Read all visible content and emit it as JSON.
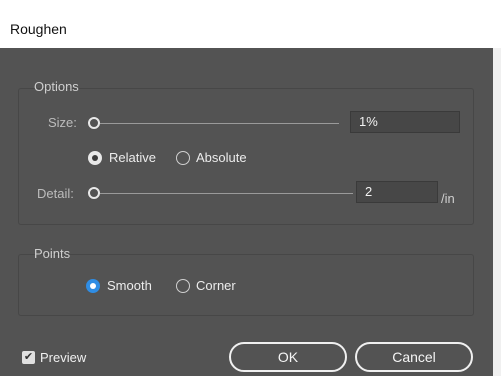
{
  "window": {
    "title": "Roughen"
  },
  "options": {
    "group_label": "Options",
    "size": {
      "label": "Size:",
      "value": "1%",
      "slider_fraction": 0.0
    },
    "mode": {
      "options": [
        {
          "label": "Relative",
          "selected": true
        },
        {
          "label": "Absolute",
          "selected": false
        }
      ]
    },
    "detail": {
      "label": "Detail:",
      "value": "2",
      "unit": "/in",
      "slider_fraction": 0.0
    }
  },
  "points": {
    "group_label": "Points",
    "options": [
      {
        "label": "Smooth",
        "selected": true
      },
      {
        "label": "Corner",
        "selected": false
      }
    ]
  },
  "footer": {
    "preview": {
      "label": "Preview",
      "checked": true
    },
    "ok_label": "OK",
    "cancel_label": "Cancel"
  },
  "colors": {
    "accent": "#2f8de4",
    "panel": "#535353"
  }
}
